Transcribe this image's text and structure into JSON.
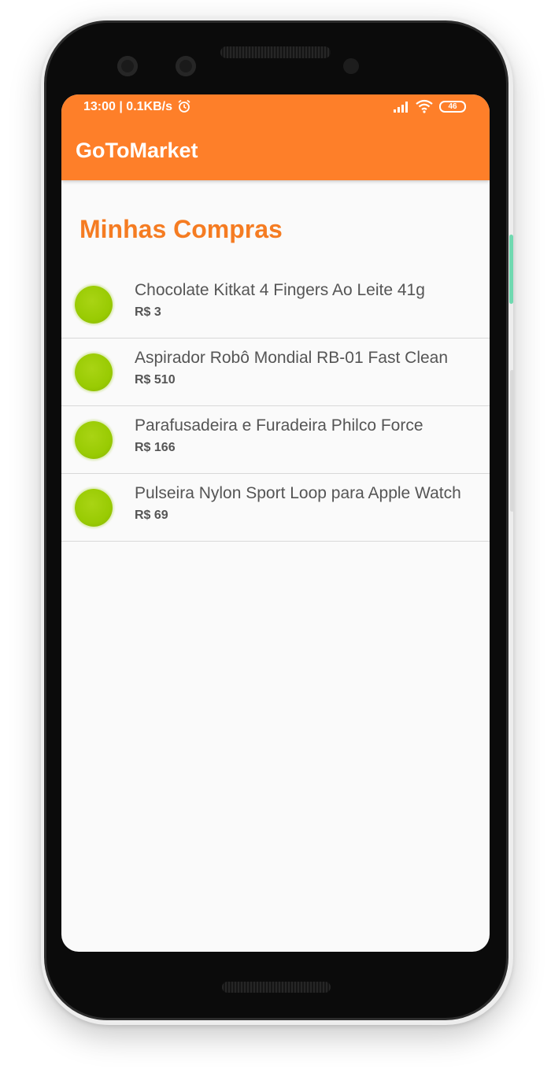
{
  "status_bar": {
    "time": "13:00 | 0.1KB/s",
    "battery": "46"
  },
  "app_bar": {
    "title": "GoToMarket"
  },
  "main": {
    "title": "Minhas Compras"
  },
  "items": [
    {
      "name": "Chocolate Kitkat 4 Fingers Ao Leite 41g",
      "price": "R$ 3"
    },
    {
      "name": "Aspirador Robô Mondial RB-01 Fast Clean",
      "price": "R$ 510"
    },
    {
      "name": "Parafusadeira e Furadeira Philco Force",
      "price": "R$ 166"
    },
    {
      "name": "Pulseira Nylon Sport Loop para Apple Watch",
      "price": "R$ 69"
    }
  ],
  "colors": {
    "accent": "#fe7f29",
    "title": "#f57c22",
    "item_dot": "#99cb03"
  },
  "icons": [
    "alarm-icon",
    "signal-icon",
    "wifi-icon",
    "battery-icon"
  ]
}
